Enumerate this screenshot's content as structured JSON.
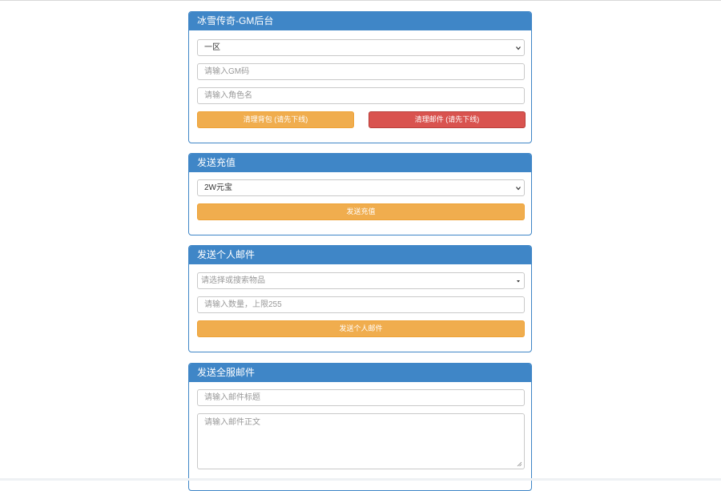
{
  "panel_gm": {
    "title": "冰雪传奇-GM后台",
    "zone_select": "一区",
    "gm_code_placeholder": "请输入GM码",
    "role_name_placeholder": "请输入角色名",
    "clear_bag_label": "清理背包 (请先下线)",
    "clear_mail_label": "清理邮件 (请先下线)"
  },
  "panel_recharge": {
    "title": "发送充值",
    "amount_select": "2W元宝",
    "send_label": "发送充值"
  },
  "panel_personal_mail": {
    "title": "发送个人邮件",
    "item_select_placeholder": "请选择或搜索物品",
    "quantity_placeholder": "请输入数量，上限255",
    "send_label": "发送个人邮件"
  },
  "panel_all_mail": {
    "title": "发送全服邮件",
    "subject_placeholder": "请输入邮件标题",
    "body_placeholder": "请输入邮件正文"
  },
  "colors": {
    "panel_header": "#3f86c7",
    "warning": "#f0ad4e",
    "danger": "#d9534f"
  },
  "icons": [
    "chevron-down-icon",
    "caret-down-icon",
    "resize-handle-icon"
  ]
}
